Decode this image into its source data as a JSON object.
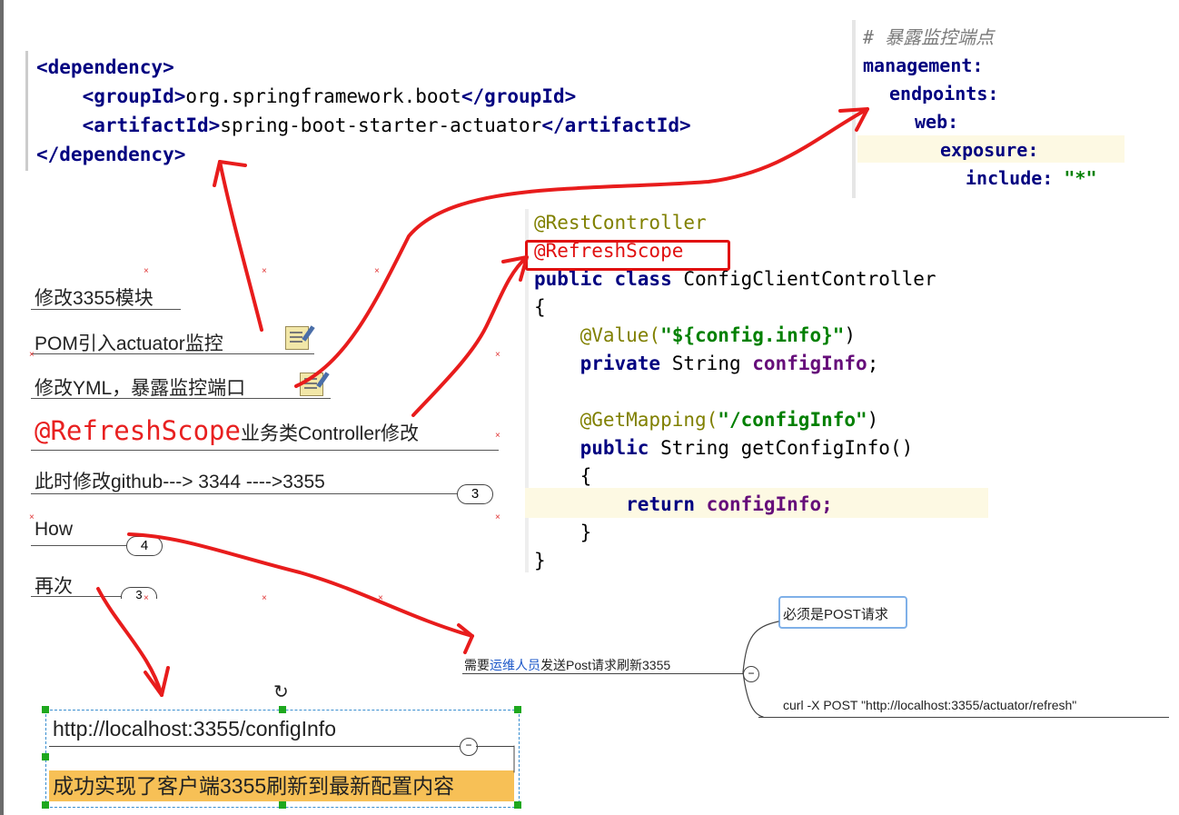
{
  "xml": {
    "line1_open": "<dependency>",
    "line2_open": "<groupId>",
    "line2_value": "org.springframework.boot",
    "line2_close": "</groupId>",
    "line3_open": "<artifactId>",
    "line3_value": "spring-boot-starter-actuator",
    "line3_close": "</artifactId>",
    "line4_close": "</dependency>"
  },
  "yml": {
    "comment": "# 暴露监控端点",
    "l1": "management:",
    "l2": "endpoints:",
    "l3": "web:",
    "l4": "exposure:",
    "l5_key": "include:",
    "l5_val": "\"*\""
  },
  "java": {
    "rest": "@RestController",
    "refresh": "@RefreshScope",
    "class_kw": "public class",
    "class_name": "ConfigClientController",
    "brace_open": "{",
    "value_ann": "@Value(",
    "value_str": "\"${config.info}\"",
    "value_close": ")",
    "field_kw": "private",
    "field_type": "String",
    "field_name": "configInfo",
    "semi": ";",
    "get_ann": "@GetMapping(",
    "get_str": "\"/configInfo\"",
    "get_close": ")",
    "method_kw": "public",
    "method_sig": "String getConfigInfo()",
    "inner_open": "{",
    "return_kw": "return",
    "return_val": "configInfo;",
    "inner_close": "}",
    "brace_close": "}"
  },
  "mindmap": {
    "n1": "修改3355模块",
    "n2": "POM引入actuator监控",
    "n3": "修改YML，暴露监控端口",
    "n4_refresh": "@RefreshScope",
    "n4_rest": "业务类Controller修改",
    "n5": "此时修改github---> 3344 ---->3355",
    "n5_count": "3",
    "n6": "How",
    "n6_count": "4",
    "n7": "再次",
    "n7_count": "3"
  },
  "right_map": {
    "main_prefix": "需要",
    "main_link": "运维人员",
    "main_suffix": "发送Post请求刷新3355",
    "post_required": "必须是POST请求",
    "curl": "curl -X POST \"http://localhost:3355/actuator/refresh\""
  },
  "bottom": {
    "url": "http://localhost:3355/configInfo",
    "success": "成功实现了客户端3355刷新到最新配置内容"
  },
  "colors": {
    "arrow": "#e81c1c",
    "highlight": "#f7c056",
    "xml_tag": "#000080"
  }
}
